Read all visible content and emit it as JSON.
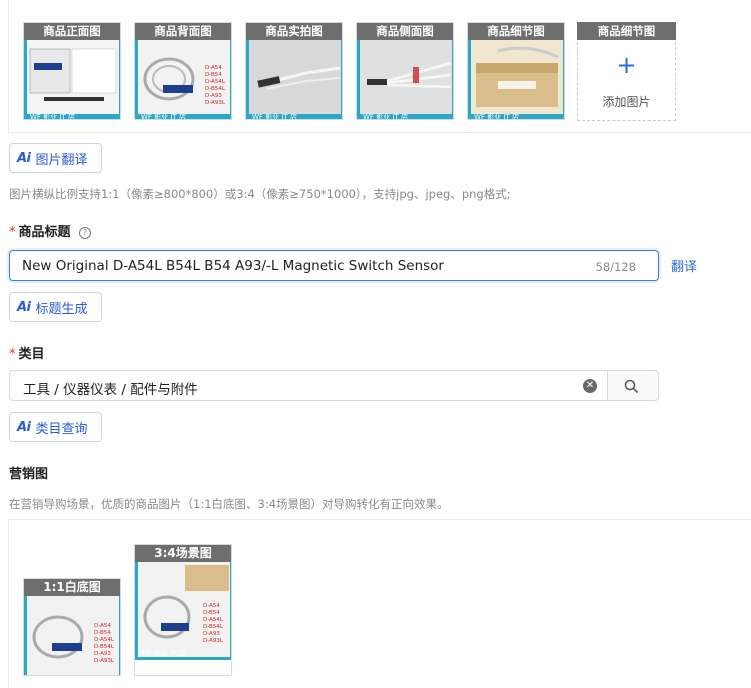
{
  "product_images": {
    "slots": [
      {
        "label": "商品正面图",
        "variant": "box"
      },
      {
        "label": "商品背面图",
        "variant": "cable"
      },
      {
        "label": "商品实拍图",
        "variant": "sensor-gray"
      },
      {
        "label": "商品侧面图",
        "variant": "sensor-multi"
      },
      {
        "label": "商品细节图",
        "variant": "box-bag"
      }
    ],
    "add_slot": {
      "label": "商品细节图",
      "add_text": "添加图片"
    },
    "photo_models": [
      "D-A54",
      "D-B54",
      "D-A54L",
      "D-B54L",
      "D-A93",
      "D-A93L"
    ],
    "watermark": "WF 影业 IT 店"
  },
  "image_translate_button": "图片翻译",
  "image_hint": "图片横纵比例支持1:1（像素≥800*800）或3:4（像素≥750*1000），支持jpg、jpeg、png格式;",
  "title_section": {
    "label": "商品标题",
    "input_value": "New Original D-A54L B54L B54 A93/-L Magnetic Switch Sensor",
    "char_count": "58/128",
    "translate_link": "翻译",
    "generate_button": "标题生成"
  },
  "category_section": {
    "label": "类目",
    "value": "工具 / 仪器仪表 / 配件与附件",
    "query_button": "类目查询"
  },
  "marketing_section": {
    "label": "营销图",
    "hint": "在营销导购场景，优质的商品图片（1:1白底图、3:4场景图）对导购转化有正向效果。",
    "images": [
      {
        "label": "1:1白底图"
      },
      {
        "label": "3:4场景图"
      }
    ]
  },
  "colors": {
    "accent": "#1f6fe5",
    "thumb_label_bg": "#6e6e6e",
    "required": "#e3342f",
    "teal_frame": "#2aa8c8"
  }
}
